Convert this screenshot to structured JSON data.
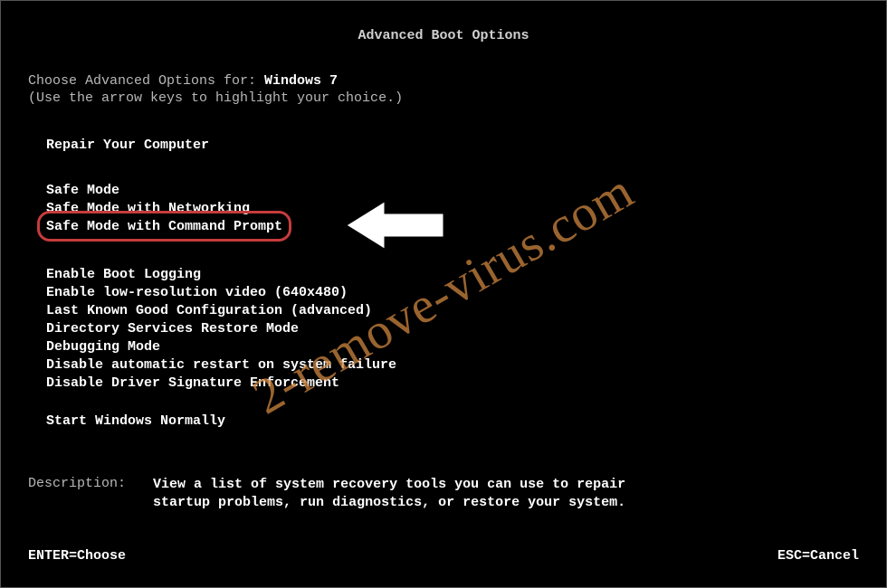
{
  "title": "Advanced Boot Options",
  "prompt": {
    "prefix": "Choose Advanced Options for: ",
    "os": "Windows 7",
    "instruction": "(Use the arrow keys to highlight your choice.)"
  },
  "groups": {
    "g1": {
      "items": [
        "Repair Your Computer"
      ]
    },
    "g2": {
      "items": [
        "Safe Mode",
        "Safe Mode with Networking",
        "Safe Mode with Command Prompt"
      ],
      "highlighted_index": 2
    },
    "g3": {
      "items": [
        "Enable Boot Logging",
        "Enable low-resolution video (640x480)",
        "Last Known Good Configuration (advanced)",
        "Directory Services Restore Mode",
        "Debugging Mode",
        "Disable automatic restart on system failure",
        "Disable Driver Signature Enforcement"
      ]
    },
    "g4": {
      "items": [
        "Start Windows Normally"
      ]
    }
  },
  "description": {
    "label": "Description:",
    "text": "View a list of system recovery tools you can use to repair startup problems, run diagnostics, or restore your system."
  },
  "footer": {
    "enter": "ENTER=Choose",
    "esc": "ESC=Cancel"
  },
  "watermark": "2-remove-virus.com",
  "colors": {
    "highlight_border": "#c73c3c",
    "watermark": "rgba(205,133,63,0.75)"
  }
}
